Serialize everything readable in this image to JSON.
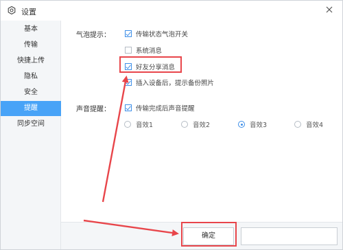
{
  "window": {
    "title": "设置"
  },
  "sidebar": {
    "items": [
      {
        "label": "基本",
        "active": false
      },
      {
        "label": "传输",
        "active": false
      },
      {
        "label": "快捷上传",
        "active": false
      },
      {
        "label": "隐私",
        "active": false
      },
      {
        "label": "安全",
        "active": false
      },
      {
        "label": "提醒",
        "active": true
      },
      {
        "label": "同步空间",
        "active": false
      }
    ]
  },
  "bubble": {
    "label": "气泡提示：",
    "options": [
      {
        "label": "传输状态气泡开关",
        "checked": true
      },
      {
        "label": "系统消息",
        "checked": false
      },
      {
        "label": "好友分享消息",
        "checked": true
      },
      {
        "label": "插入设备后，提示备份照片",
        "checked": true
      }
    ]
  },
  "sound": {
    "label": "声音提醒：",
    "toggle": {
      "label": "传输完成后声音提醒",
      "checked": true
    },
    "effects": [
      {
        "label": "音效1",
        "selected": false
      },
      {
        "label": "音效2",
        "selected": false
      },
      {
        "label": "音效3",
        "selected": true
      },
      {
        "label": "音效4",
        "selected": false
      }
    ]
  },
  "footer": {
    "ok_label": "确定",
    "cancel_label": ""
  },
  "colors": {
    "accent": "#48a3f7",
    "annotation": "#e8454a",
    "check": "#3d8ee8"
  }
}
